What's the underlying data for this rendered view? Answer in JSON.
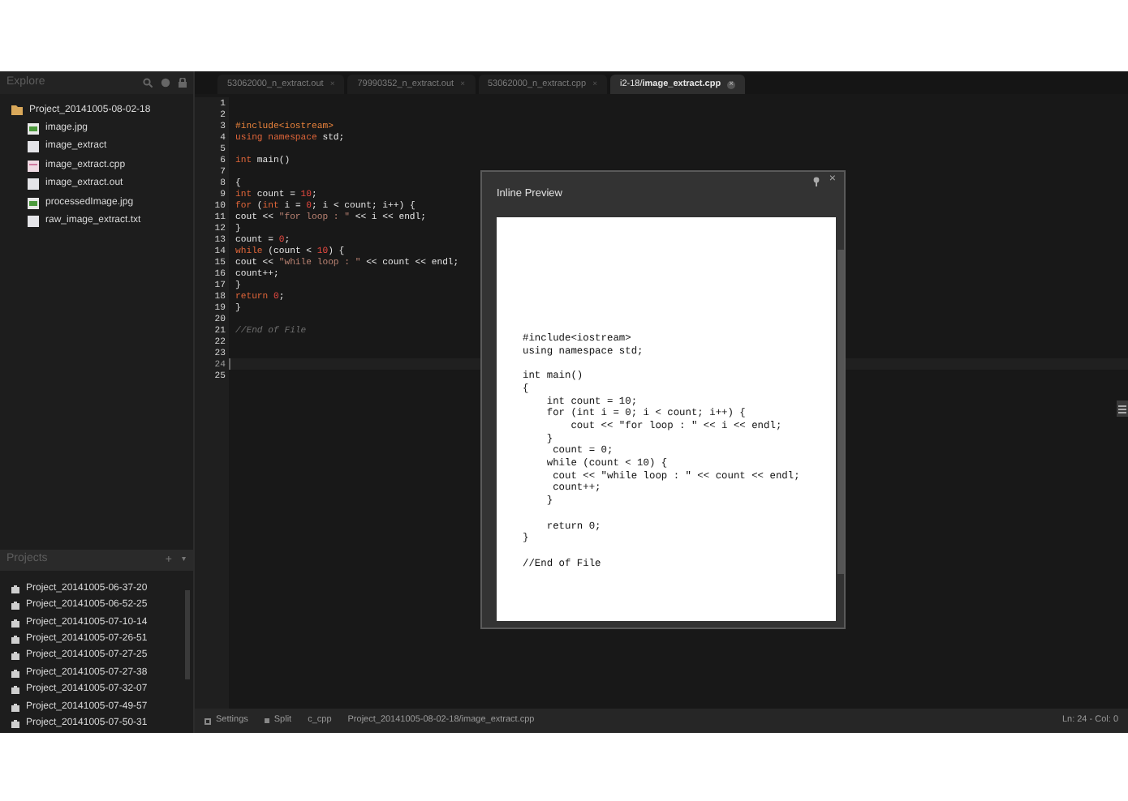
{
  "sidebar": {
    "explore": {
      "title": "Explore",
      "root": {
        "label": "Project_20141005-08-02-18",
        "expanded": true,
        "children": [
          {
            "label": "image.jpg",
            "kind": "image"
          },
          {
            "label": "image_extract",
            "kind": "file"
          },
          {
            "label": "image_extract.cpp",
            "kind": "source"
          },
          {
            "label": "image_extract.out",
            "kind": "file"
          },
          {
            "label": "processedImage.jpg",
            "kind": "image"
          },
          {
            "label": "raw_image_extract.txt",
            "kind": "file"
          }
        ]
      }
    },
    "projects": {
      "title": "Projects",
      "add": "+",
      "menu": "▾",
      "items": [
        "Project_20141005-06-37-20",
        "Project_20141005-06-52-25",
        "Project_20141005-07-10-14",
        "Project_20141005-07-26-51",
        "Project_20141005-07-27-25",
        "Project_20141005-07-27-38",
        "Project_20141005-07-32-07",
        "Project_20141005-07-49-57",
        "Project_20141005-07-50-31"
      ]
    }
  },
  "tabs": [
    {
      "label": "53062000_n_extract.out",
      "close": "×",
      "selected": false
    },
    {
      "label": "79990352_n_extract.out",
      "close": "×",
      "selected": false
    },
    {
      "label": "53062000_n_extract.cpp",
      "close": "×",
      "selected": false
    },
    {
      "label": "i2-18/**image_extract.cpp**",
      "close": "×",
      "selected": true
    }
  ],
  "editor": {
    "lines": [
      {
        "number": "1",
        "current": false
      },
      {
        "number": "2",
        "current": false
      },
      {
        "number": "3",
        "current": false,
        "tokens": [
          {
            "text": "#include<iostream>",
            "kind": "directive"
          }
        ]
      },
      {
        "number": "4",
        "current": false,
        "tokens": [
          {
            "text": "using namespace",
            "kind": "keyword"
          },
          {
            "text": " std;",
            "kind": "plain"
          }
        ]
      },
      {
        "number": "5",
        "current": false
      },
      {
        "number": "6",
        "current": false,
        "tokens": [
          {
            "text": "int",
            "kind": "keyword"
          },
          {
            "text": " main()",
            "kind": "plain"
          }
        ]
      },
      {
        "number": "7",
        "current": false
      },
      {
        "number": "8",
        "current": false,
        "tokens": [
          {
            "text": "{",
            "kind": "plain"
          }
        ]
      },
      {
        "number": "9",
        "current": false,
        "tokens": [
          {
            "text": "int",
            "kind": "keyword"
          },
          {
            "text": " count = ",
            "kind": "plain"
          },
          {
            "text": "10",
            "kind": "number"
          },
          {
            "text": ";",
            "kind": "plain"
          }
        ]
      },
      {
        "number": "10",
        "current": false,
        "tokens": [
          {
            "text": "for",
            "kind": "keyword"
          },
          {
            "text": " (",
            "kind": "plain"
          },
          {
            "text": "int",
            "kind": "keyword"
          },
          {
            "text": " i = ",
            "kind": "plain"
          },
          {
            "text": "0",
            "kind": "number"
          },
          {
            "text": "; i < count; i++) {",
            "kind": "plain"
          }
        ]
      },
      {
        "number": "11",
        "current": false,
        "tokens": [
          {
            "text": "cout << ",
            "kind": "plain"
          },
          {
            "text": "\"for loop : \"",
            "kind": "string"
          },
          {
            "text": " << i << endl;",
            "kind": "plain"
          }
        ]
      },
      {
        "number": "12",
        "current": false,
        "tokens": [
          {
            "text": "}",
            "kind": "plain"
          }
        ]
      },
      {
        "number": "13",
        "current": false,
        "tokens": [
          {
            "text": "count = ",
            "kind": "plain"
          },
          {
            "text": "0",
            "kind": "number"
          },
          {
            "text": ";",
            "kind": "plain"
          }
        ]
      },
      {
        "number": "14",
        "current": false,
        "tokens": [
          {
            "text": "while",
            "kind": "keyword"
          },
          {
            "text": " (count < ",
            "kind": "plain"
          },
          {
            "text": "10",
            "kind": "number"
          },
          {
            "text": ") {",
            "kind": "plain"
          }
        ]
      },
      {
        "number": "15",
        "current": false,
        "tokens": [
          {
            "text": "cout << ",
            "kind": "plain"
          },
          {
            "text": "\"while loop : \"",
            "kind": "string"
          },
          {
            "text": " << count << endl;",
            "kind": "plain"
          }
        ]
      },
      {
        "number": "16",
        "current": false,
        "tokens": [
          {
            "text": "count++;",
            "kind": "plain"
          }
        ]
      },
      {
        "number": "17",
        "current": false,
        "tokens": [
          {
            "text": "}",
            "kind": "plain"
          }
        ]
      },
      {
        "number": "18",
        "current": false,
        "tokens": [
          {
            "text": "return ",
            "kind": "keyword"
          },
          {
            "text": "0",
            "kind": "number"
          },
          {
            "text": ";",
            "kind": "plain"
          }
        ]
      },
      {
        "number": "19",
        "current": false,
        "tokens": [
          {
            "text": "}",
            "kind": "plain"
          }
        ]
      },
      {
        "number": "20",
        "current": false
      },
      {
        "number": "21",
        "current": false,
        "tokens": [
          {
            "text": "//End of File",
            "kind": "comment"
          }
        ]
      },
      {
        "number": "22",
        "current": false
      },
      {
        "number": "23",
        "current": false
      },
      {
        "number": "24",
        "current": true
      },
      {
        "number": "25",
        "current": false
      }
    ]
  },
  "inline_preview": {
    "title": "Inline Preview",
    "close": "×",
    "document_blocks": [
      [
        "#include<iostream>",
        "using namespace std;"
      ],
      [
        "int main()",
        "{",
        "    int count = 10;",
        "    for (int i = 0; i < count; i++) {",
        "        cout << \"for loop : \" << i << endl;",
        "    }",
        "     count = 0;",
        "    while (count < 10) {",
        "     cout << \"while loop : \" << count << endl;",
        "     count++;",
        "    }"
      ],
      [
        "    return 0;",
        "}"
      ],
      [
        "//End of File"
      ]
    ]
  },
  "status_bar": {
    "settings": "Settings",
    "split": "Split",
    "mode": "c_cpp",
    "path": "Project_20141005-08-02-18/image_extract.cpp",
    "position": "Ln: 24 - Col: 0"
  }
}
